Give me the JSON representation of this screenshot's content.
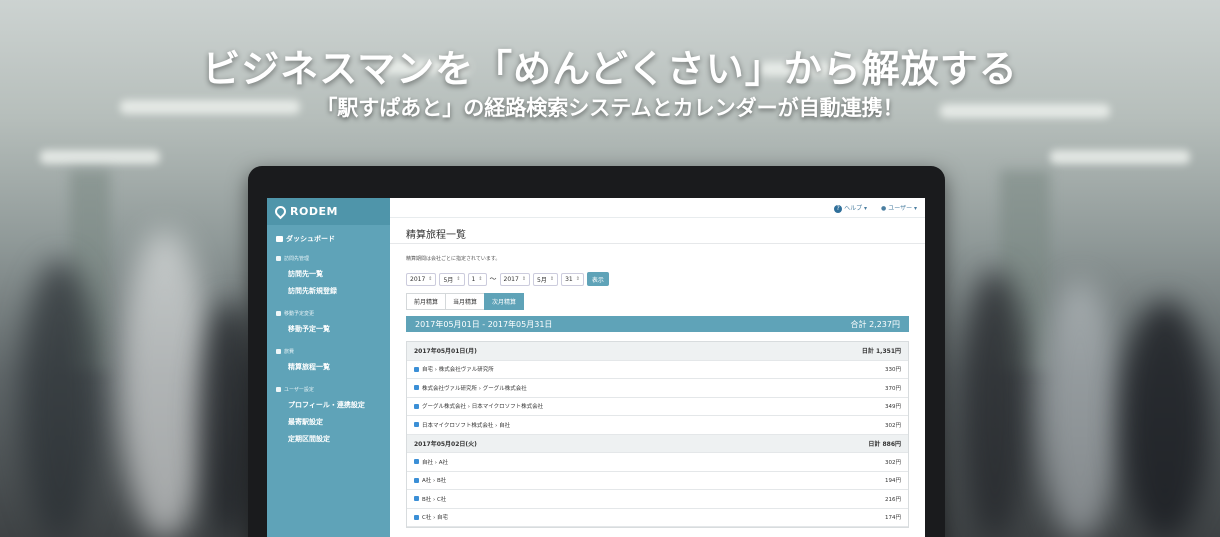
{
  "hero": {
    "headline": "ビジネスマンを「めんどくさい」から解放する",
    "subline": "「駅すぱあと」の経路検索システムとカレンダーが自動連携！"
  },
  "app": {
    "logo": "RODEM",
    "sidebar": {
      "dashboard": "ダッシュボード",
      "sections": [
        {
          "title": "訪問先管理",
          "items": [
            "訪問先一覧",
            "訪問先新規登録"
          ]
        },
        {
          "title": "移動予定変更",
          "items": [
            "移動予定一覧"
          ]
        },
        {
          "title": "旅費",
          "items": [
            "精算旅程一覧"
          ]
        },
        {
          "title": "ユーザー設定",
          "items": [
            "プロフィール・連携設定",
            "最寄駅設定",
            "定期区間設定"
          ]
        }
      ]
    },
    "topbar": {
      "help": "ヘルプ",
      "user": "ユーザー"
    },
    "page_title": "精算旅程一覧",
    "note": "精算期間は会社ごとに指定されています。",
    "filters": {
      "from": {
        "year": "2017",
        "month": "5月",
        "day": "1"
      },
      "tilde": "〜",
      "to": {
        "year": "2017",
        "month": "5月",
        "day": "31"
      },
      "show_button": "表示"
    },
    "tabs": [
      "前月精算",
      "当月精算",
      "次月精算"
    ],
    "active_tab_index": 2,
    "period": {
      "range": "2017年05月01日 - 2017年05月31日",
      "total": "合計 2,237円"
    },
    "days": [
      {
        "date": "2017年05月01日(月)",
        "subtotal": "日計 1,351円",
        "routes": [
          {
            "route": "自宅 › 株式会社ヴァル研究所",
            "fare": "330円"
          },
          {
            "route": "株式会社ヴァル研究所 › グーグル株式会社",
            "fare": "370円"
          },
          {
            "route": "グーグル株式会社 › 日本マイクロソフト株式会社",
            "fare": "349円"
          },
          {
            "route": "日本マイクロソフト株式会社 › 自社",
            "fare": "302円"
          }
        ]
      },
      {
        "date": "2017年05月02日(火)",
        "subtotal": "日計 886円",
        "routes": [
          {
            "route": "自社 › A社",
            "fare": "302円"
          },
          {
            "route": "A社 › B社",
            "fare": "194円"
          },
          {
            "route": "B社 › C社",
            "fare": "216円"
          },
          {
            "route": "C社 › 自宅",
            "fare": "174円"
          }
        ]
      }
    ]
  },
  "colors": {
    "accent": "#5fa3b8",
    "checkbox": "#3b8fd6"
  }
}
